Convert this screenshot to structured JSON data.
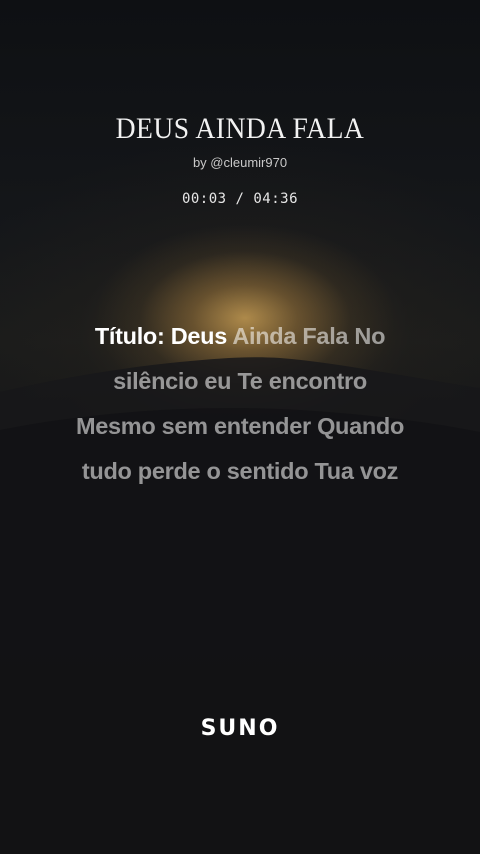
{
  "song": {
    "title": "DEUS AINDA FALA",
    "byline": "by @cleumir970"
  },
  "player": {
    "time_display": "00:03 / 04:36"
  },
  "lyrics": {
    "line1_sung": "Título: Deus",
    "line1_unsung": " Ainda Fala No",
    "line2": "silêncio eu Te encontro",
    "line3": "Mesmo sem entender Quando",
    "line4": "tudo perde o sentido Tua voz"
  },
  "brand": {
    "logo": "SUNO"
  }
}
